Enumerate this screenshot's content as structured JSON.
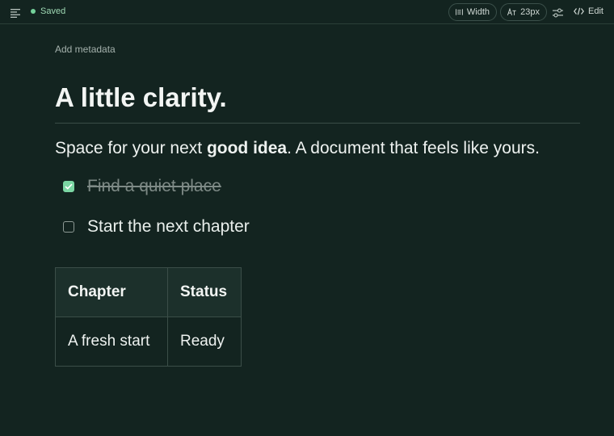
{
  "status": {
    "saved_label": "Saved",
    "color": "#74d19a"
  },
  "toolbar": {
    "width_label": "Width",
    "font_size_label": "23px",
    "edit_label": "Edit"
  },
  "document": {
    "add_metadata": "Add metadata",
    "title": "A little clarity.",
    "paragraph": {
      "before": "Space for your next ",
      "bold": "good idea",
      "after": ". A document that feels like yours."
    },
    "tasks": [
      {
        "label": "Find a quiet place",
        "checked": true
      },
      {
        "label": "Start the next chapter",
        "checked": false
      }
    ],
    "table": {
      "headers": [
        "Chapter",
        "Status"
      ],
      "rows": [
        [
          "A fresh start",
          "Ready"
        ]
      ]
    }
  },
  "colors": {
    "background": "#132420",
    "accent": "#7bd6a3"
  }
}
